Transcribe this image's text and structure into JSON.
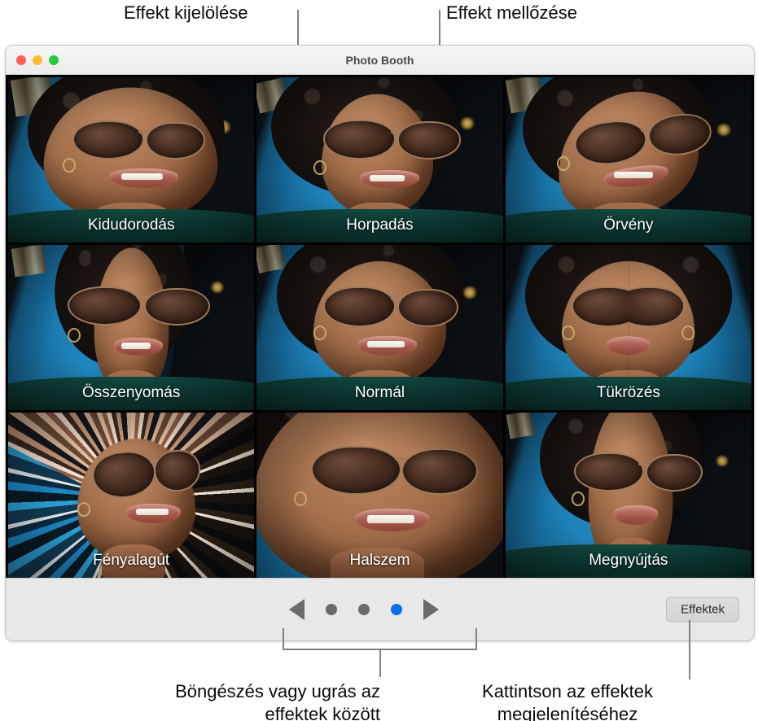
{
  "window": {
    "title": "Photo Booth",
    "traffic_lights": [
      {
        "name": "close",
        "color": "#ff5f57"
      },
      {
        "name": "minimize",
        "color": "#febc2e"
      },
      {
        "name": "zoom",
        "color": "#28c840"
      }
    ]
  },
  "effects_grid": {
    "rows": 3,
    "columns": 3,
    "cells": [
      {
        "label": "Kidudorodás",
        "fx": "bulge",
        "selected": false
      },
      {
        "label": "Horpadás",
        "fx": "dent",
        "selected": false
      },
      {
        "label": "Örvény",
        "fx": "twirl",
        "selected": false
      },
      {
        "label": "Összenyomás",
        "fx": "squeeze",
        "selected": false
      },
      {
        "label": "Normál",
        "fx": "normal",
        "selected": true
      },
      {
        "label": "Tükrözés",
        "fx": "mirror",
        "selected": false
      },
      {
        "label": "Fényalagút",
        "fx": "tunnel",
        "selected": false
      },
      {
        "label": "Halszem",
        "fx": "fisheye",
        "selected": false
      },
      {
        "label": "Megnyújtás",
        "fx": "stretch",
        "selected": false
      }
    ]
  },
  "toolbar": {
    "previous_label": "◀",
    "next_label": "▶",
    "page_dots": [
      {
        "active": false
      },
      {
        "active": false
      },
      {
        "active": true
      }
    ],
    "effects_button_label": "Effektek",
    "accent_color": "#0a6fe8"
  },
  "callouts": {
    "top_left": "Effekt kijelölése",
    "top_right": "Effekt mellőzése",
    "bottom_left_line1": "Böngészés vagy ugrás az",
    "bottom_left_line2": "effektek között",
    "bottom_right_line1": "Kattintson az effektek",
    "bottom_right_line2": "megjelenítéséhez"
  }
}
